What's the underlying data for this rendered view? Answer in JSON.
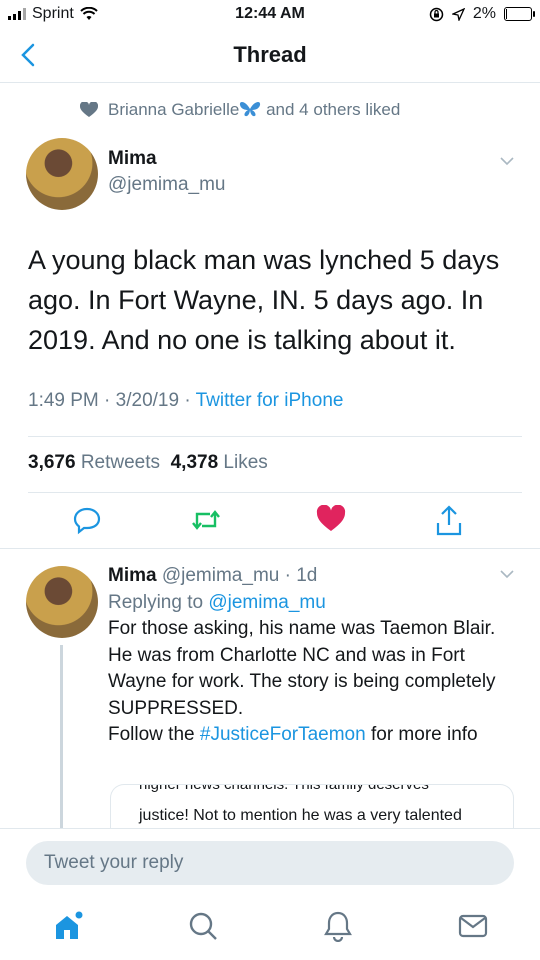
{
  "status_bar": {
    "carrier": "Sprint",
    "time": "12:44 AM",
    "battery": "2%",
    "battery_level": 0.02
  },
  "header": {
    "title": "Thread"
  },
  "social_context": {
    "liked_by": "Brianna Gabrielle",
    "liked_suffix": "and 4 others liked"
  },
  "tweet": {
    "name": "Mima",
    "handle": "@jemima_mu",
    "text": "A young black man was lynched 5 days ago. In Fort Wayne, IN. 5 days ago. In 2019. And no one is talking about it.",
    "time": "1:49 PM",
    "date": "3/20/19",
    "source": "Twitter for iPhone",
    "retweets_count": "3,676",
    "retweets_label": "Retweets",
    "likes_count": "4,378",
    "likes_label": "Likes"
  },
  "reply": {
    "name": "Mima",
    "handle": "@jemima_mu",
    "age": "1d",
    "replying_to_label": "Replying to",
    "replying_to_handle": "@jemima_mu",
    "text_main": "For those asking, his name was Taemon Blair. He was from Charlotte NC and was in Fort Wayne for work. The story is being completely SUPPRESSED.",
    "text_follow": "Follow the",
    "hashtag": "#JusticeForTaemon",
    "text_end": "for more info",
    "quoted_clipped": "higher news channels. This family deserves",
    "quoted_text": "justice! Not to mention he was a very talented"
  },
  "composer": {
    "placeholder": "Tweet your reply"
  },
  "colors": {
    "accent": "#1b95e0",
    "like": "#e0245e",
    "retweet": "#17bf63",
    "muted": "#657786"
  },
  "icons": [
    "back-chevron-icon",
    "heart-icon",
    "butterfly-emoji-icon",
    "chevron-down-icon",
    "reply-icon",
    "retweet-icon",
    "like-icon",
    "share-icon",
    "home-icon",
    "search-icon",
    "notifications-icon",
    "messages-icon"
  ]
}
